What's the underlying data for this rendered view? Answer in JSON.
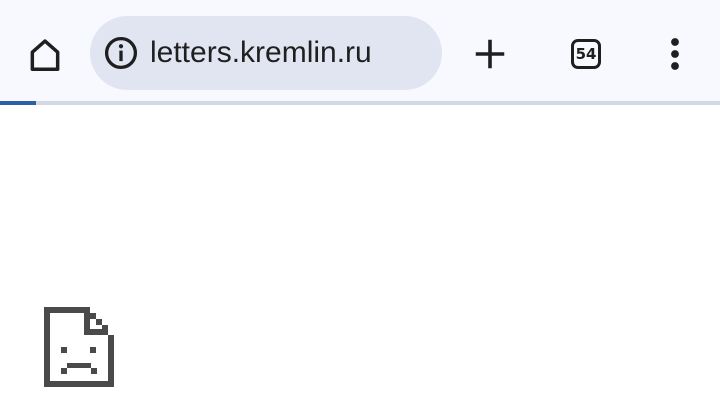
{
  "toolbar": {
    "home_icon": "home-icon",
    "site_info_icon": "info-icon",
    "url": "letters.kremlin.ru",
    "new_tab_icon": "plus-icon",
    "tab_count": "54",
    "menu_icon": "more-vert-icon"
  },
  "load_progress": {
    "fraction": 0.05,
    "fill_color": "#2f5ea8",
    "track_color": "#d3d8e6"
  },
  "page": {
    "error_icon": "sad-page-icon"
  },
  "colors": {
    "toolbar_bg": "#f8f9ff",
    "omnibox_bg": "#e1e5f2",
    "icon": "#1f1f1f"
  }
}
